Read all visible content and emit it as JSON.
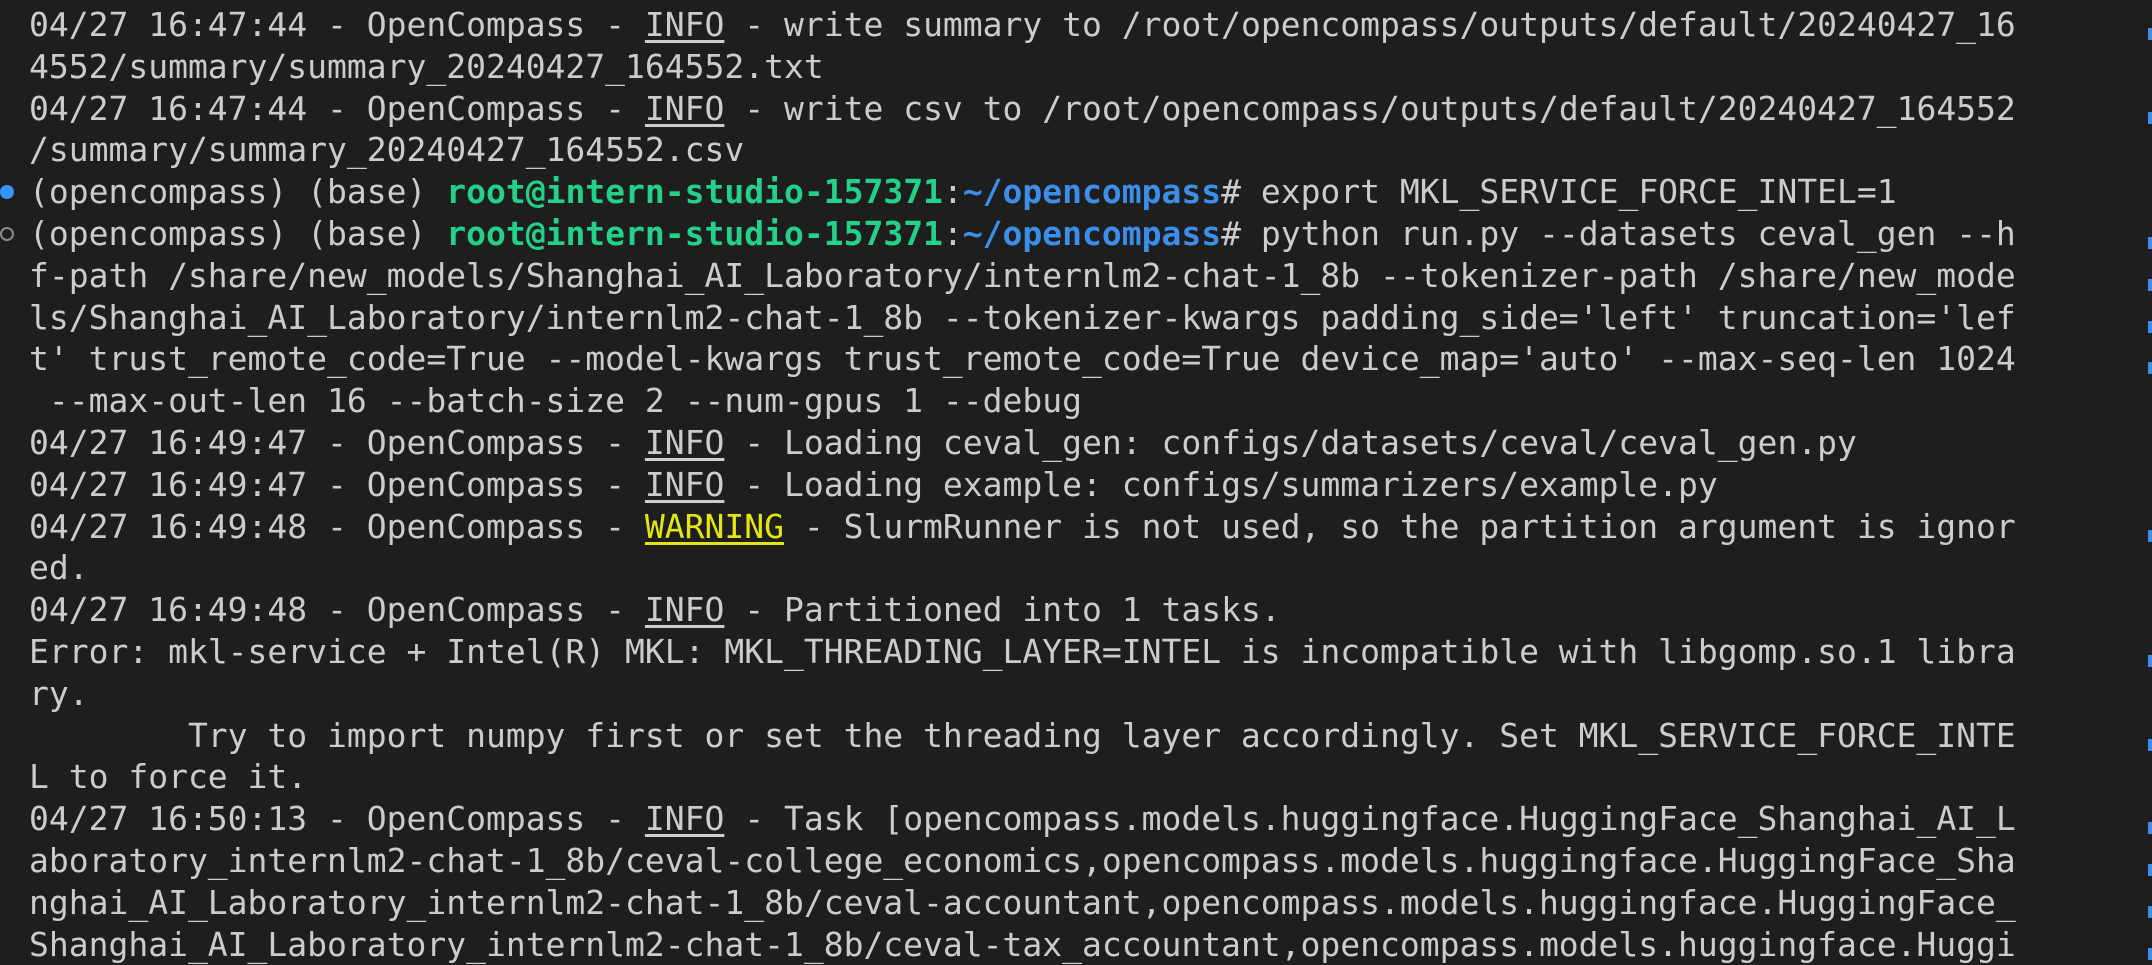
{
  "terminal": {
    "lines": [
      {
        "segments": [
          {
            "t": "04/27 16:47:44 - OpenCompass - ",
            "c": ""
          },
          {
            "t": "INFO",
            "c": "info"
          },
          {
            "t": " - write summary to /root/opencompass/outputs/default/20240427_16",
            "c": ""
          }
        ]
      },
      {
        "segments": [
          {
            "t": "4552/summary/summary_20240427_164552.txt",
            "c": ""
          }
        ]
      },
      {
        "segments": [
          {
            "t": "04/27 16:47:44 - OpenCompass - ",
            "c": ""
          },
          {
            "t": "INFO",
            "c": "info"
          },
          {
            "t": " - write csv to /root/opencompass/outputs/default/20240427_164552",
            "c": ""
          }
        ]
      },
      {
        "segments": [
          {
            "t": "/summary/summary_20240427_164552.csv",
            "c": ""
          }
        ]
      },
      {
        "decoration": "success",
        "segments": [
          {
            "t": "(opencompass) (base) ",
            "c": ""
          },
          {
            "t": "root@intern-studio-157371",
            "c": "user"
          },
          {
            "t": ":",
            "c": ""
          },
          {
            "t": "~/opencompass",
            "c": "path"
          },
          {
            "t": "# export MKL_SERVICE_FORCE_INTEL=1",
            "c": ""
          }
        ]
      },
      {
        "decoration": "running",
        "segments": [
          {
            "t": "(opencompass) (base) ",
            "c": ""
          },
          {
            "t": "root@intern-studio-157371",
            "c": "user"
          },
          {
            "t": ":",
            "c": ""
          },
          {
            "t": "~/opencompass",
            "c": "path"
          },
          {
            "t": "# python run.py --datasets ceval_gen --h",
            "c": ""
          }
        ]
      },
      {
        "segments": [
          {
            "t": "f-path /share/new_models/Shanghai_AI_Laboratory/internlm2-chat-1_8b --tokenizer-path /share/new_mode",
            "c": ""
          }
        ]
      },
      {
        "segments": [
          {
            "t": "ls/Shanghai_AI_Laboratory/internlm2-chat-1_8b --tokenizer-kwargs padding_side='left' truncation='lef",
            "c": ""
          }
        ]
      },
      {
        "segments": [
          {
            "t": "t' trust_remote_code=True --model-kwargs trust_remote_code=True device_map='auto' --max-seq-len 1024",
            "c": ""
          }
        ]
      },
      {
        "segments": [
          {
            "t": " --max-out-len 16 --batch-size 2 --num-gpus 1 --debug",
            "c": ""
          }
        ]
      },
      {
        "segments": [
          {
            "t": "04/27 16:49:47 - OpenCompass - ",
            "c": ""
          },
          {
            "t": "INFO",
            "c": "info"
          },
          {
            "t": " - Loading ceval_gen: configs/datasets/ceval/ceval_gen.py",
            "c": ""
          }
        ]
      },
      {
        "segments": [
          {
            "t": "04/27 16:49:47 - OpenCompass - ",
            "c": ""
          },
          {
            "t": "INFO",
            "c": "info"
          },
          {
            "t": " - Loading example: configs/summarizers/example.py",
            "c": ""
          }
        ]
      },
      {
        "segments": [
          {
            "t": "04/27 16:49:48 - OpenCompass - ",
            "c": ""
          },
          {
            "t": "WARNING",
            "c": "warn"
          },
          {
            "t": " - SlurmRunner is not used, so the partition argument is ignor",
            "c": ""
          }
        ]
      },
      {
        "segments": [
          {
            "t": "ed.",
            "c": ""
          }
        ]
      },
      {
        "segments": [
          {
            "t": "04/27 16:49:48 - OpenCompass - ",
            "c": ""
          },
          {
            "t": "INFO",
            "c": "info"
          },
          {
            "t": " - Partitioned into 1 tasks.",
            "c": ""
          }
        ]
      },
      {
        "segments": [
          {
            "t": "Error: mkl-service + Intel(R) MKL: MKL_THREADING_LAYER=INTEL is incompatible with libgomp.so.1 libra",
            "c": ""
          }
        ]
      },
      {
        "segments": [
          {
            "t": "ry.",
            "c": ""
          }
        ]
      },
      {
        "segments": [
          {
            "t": "        Try to import numpy first or set the threading layer accordingly. Set MKL_SERVICE_FORCE_INTE",
            "c": ""
          }
        ]
      },
      {
        "segments": [
          {
            "t": "L to force it.",
            "c": ""
          }
        ]
      },
      {
        "segments": [
          {
            "t": "04/27 16:50:13 - OpenCompass - ",
            "c": ""
          },
          {
            "t": "INFO",
            "c": "info"
          },
          {
            "t": " - Task [opencompass.models.huggingface.HuggingFace_Shanghai_AI_L",
            "c": ""
          }
        ]
      },
      {
        "segments": [
          {
            "t": "aboratory_internlm2-chat-1_8b/ceval-college_economics,opencompass.models.huggingface.HuggingFace_Sha",
            "c": ""
          }
        ]
      },
      {
        "segments": [
          {
            "t": "nghai_AI_Laboratory_internlm2-chat-1_8b/ceval-accountant,opencompass.models.huggingface.HuggingFace_",
            "c": ""
          }
        ]
      },
      {
        "segments": [
          {
            "t": "Shanghai_AI_Laboratory_internlm2-chat-1_8b/ceval-tax_accountant,opencompass.models.huggingface.Huggi",
            "c": ""
          }
        ]
      }
    ]
  }
}
